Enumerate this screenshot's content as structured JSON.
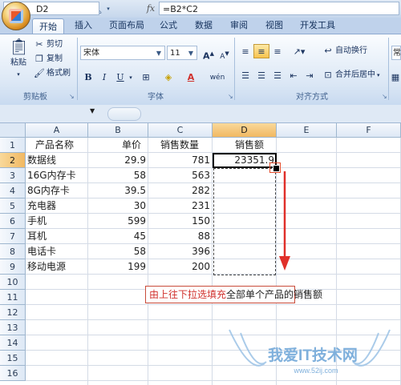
{
  "qat": {
    "save_icon": "save-icon",
    "undo_icon": "undo-icon",
    "redo_icon": "redo-icon",
    "print_preview_icon": "print-preview-icon"
  },
  "tabs": [
    "开始",
    "插入",
    "页面布局",
    "公式",
    "数据",
    "审阅",
    "视图",
    "开发工具"
  ],
  "active_tab": "开始",
  "clipboard": {
    "paste": "粘贴",
    "cut": "剪切",
    "copy": "复制",
    "format_painter": "格式刷",
    "label": "剪贴板"
  },
  "font": {
    "name": "宋体",
    "size": "11",
    "bold": "B",
    "italic": "I",
    "underline": "U",
    "grow": "A",
    "shrink": "A",
    "color_letter": "A",
    "phonetic": "wén",
    "label": "字体"
  },
  "alignment": {
    "wrap": "自动换行",
    "merge": "合并后居中",
    "label": "对齐方式"
  },
  "number": {
    "format_partial": "常"
  },
  "formula_bar": {
    "name_box": "D2",
    "fx": "fx",
    "formula": "=B2*C2"
  },
  "columns": [
    "A",
    "B",
    "C",
    "D",
    "E",
    "F"
  ],
  "rows": [
    "1",
    "2",
    "3",
    "4",
    "5",
    "6",
    "7",
    "8",
    "9",
    "10",
    "11",
    "12",
    "13",
    "14",
    "15",
    "16"
  ],
  "sheet": {
    "header": {
      "a": "产品名称",
      "b": "单价",
      "c": "销售数量",
      "d": "销售额"
    },
    "data": [
      {
        "a": "数据线",
        "b": "29.9",
        "c": "781",
        "d": "23351.9"
      },
      {
        "a": "16G内存卡",
        "b": "58",
        "c": "563",
        "d": ""
      },
      {
        "a": "8G内存卡",
        "b": "39.5",
        "c": "282",
        "d": ""
      },
      {
        "a": "充电器",
        "b": "30",
        "c": "231",
        "d": ""
      },
      {
        "a": "手机",
        "b": "599",
        "c": "150",
        "d": ""
      },
      {
        "a": "耳机",
        "b": "45",
        "c": "88",
        "d": ""
      },
      {
        "a": "电话卡",
        "b": "58",
        "c": "396",
        "d": ""
      },
      {
        "a": "移动电源",
        "b": "199",
        "c": "200",
        "d": ""
      }
    ]
  },
  "annotation": {
    "highlight": "由上往下拉选填充",
    "rest": "全部单个产品的销售额"
  },
  "watermark": {
    "title": "我爱IT技术网",
    "url": "www.52ij.com"
  }
}
